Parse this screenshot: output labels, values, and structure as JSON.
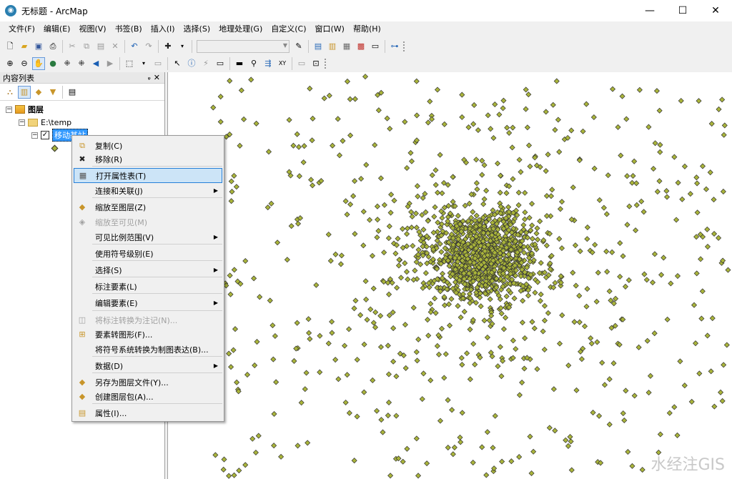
{
  "window": {
    "title": "无标题 - ArcMap",
    "minimize": "—",
    "maximize": "☐",
    "close": "✕"
  },
  "menubar": [
    "文件(F)",
    "编辑(E)",
    "视图(V)",
    "书签(B)",
    "插入(I)",
    "选择(S)",
    "地理处理(G)",
    "自定义(C)",
    "窗口(W)",
    "帮助(H)"
  ],
  "toc": {
    "title": "内容列表",
    "pin": "ᵩ",
    "close": "✕",
    "layers_root": "图层",
    "folder": "E:\\temp",
    "layer_name": "移动基站"
  },
  "context_menu": [
    {
      "label": "复制(C)",
      "icon": "copy-icon",
      "glyph": "⧉",
      "disabled": false,
      "submenu": false
    },
    {
      "label": "移除(R)",
      "icon": "remove-icon",
      "glyph": "✖",
      "disabled": false,
      "submenu": false
    },
    {
      "label": "打开属性表(T)",
      "icon": "table-icon",
      "glyph": "▦",
      "disabled": false,
      "submenu": false,
      "highlighted": true
    },
    {
      "label": "连接和关联(J)",
      "icon": "",
      "glyph": "",
      "disabled": false,
      "submenu": true
    },
    {
      "label": "缩放至图层(Z)",
      "icon": "zoom-layer-icon",
      "glyph": "◆",
      "disabled": false,
      "submenu": false
    },
    {
      "label": "缩放至可见(M)",
      "icon": "zoom-visible-icon",
      "glyph": "◈",
      "disabled": true,
      "submenu": false
    },
    {
      "label": "可见比例范围(V)",
      "icon": "",
      "glyph": "",
      "disabled": false,
      "submenu": true
    },
    {
      "label": "使用符号级别(E)",
      "icon": "",
      "glyph": "",
      "disabled": false,
      "submenu": false
    },
    {
      "label": "选择(S)",
      "icon": "",
      "glyph": "",
      "disabled": false,
      "submenu": true
    },
    {
      "label": "标注要素(L)",
      "icon": "",
      "glyph": "",
      "disabled": false,
      "submenu": false
    },
    {
      "label": "编辑要素(E)",
      "icon": "",
      "glyph": "",
      "disabled": false,
      "submenu": true
    },
    {
      "label": "将标注转换为注记(N)...",
      "icon": "convert-label-icon",
      "glyph": "◫",
      "disabled": true,
      "submenu": false
    },
    {
      "label": "要素转图形(F)...",
      "icon": "feature-graphic-icon",
      "glyph": "⊞",
      "disabled": false,
      "submenu": false
    },
    {
      "label": "将符号系统转换为制图表达(B)...",
      "icon": "",
      "glyph": "",
      "disabled": false,
      "submenu": false
    },
    {
      "label": "数据(D)",
      "icon": "",
      "glyph": "",
      "disabled": false,
      "submenu": true
    },
    {
      "label": "另存为图层文件(Y)...",
      "icon": "save-layer-icon",
      "glyph": "◆",
      "disabled": false,
      "submenu": false
    },
    {
      "label": "创建图层包(A)...",
      "icon": "layer-package-icon",
      "glyph": "◆",
      "disabled": false,
      "submenu": false
    },
    {
      "label": "属性(I)...",
      "icon": "properties-icon",
      "glyph": "▤",
      "disabled": false,
      "submenu": false
    }
  ],
  "colors": {
    "point_fill": "#a9b43a",
    "point_stroke": "#333333",
    "highlight": "#cce4f7"
  },
  "watermark": "水经注GIS"
}
